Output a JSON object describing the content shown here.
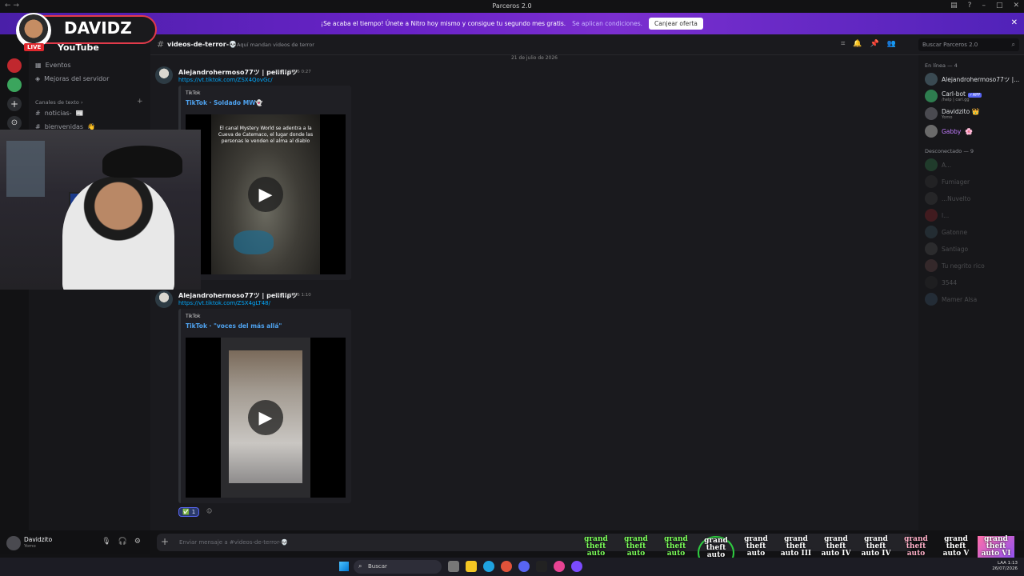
{
  "window": {
    "title": "Parceros 2.0"
  },
  "nitro_banner": {
    "message": "¡Se acaba el tiempo! Únete a Nitro hoy mismo y consigue tu segundo mes gratis.",
    "conditions": "Se aplican condiciones.",
    "button": "Canjear oferta"
  },
  "server": {
    "name": "Parceros 2.0"
  },
  "sidebar": {
    "items": [
      {
        "label": "Eventos",
        "icon": "calendar-icon"
      },
      {
        "label": "Mejoras del servidor",
        "icon": "boost-icon"
      }
    ],
    "category": "Canales de texto",
    "channels": [
      {
        "label": "noticias-",
        "emoji": "📰"
      },
      {
        "label": "bienvenidas",
        "emoji": "👋"
      }
    ]
  },
  "channel": {
    "name": "videos-de-terror-💀",
    "topic": "Aquí mandan videos de terror",
    "search_placeholder": "Buscar Parceros 2.0"
  },
  "messages": {
    "date_divider": "21 de julio de 2026",
    "list": [
      {
        "author": "Alejandrohermoso77ツ | peliflipツ",
        "timestamp": "21/07/2026 0:27",
        "link": "https://vt.tiktok.com/ZSX4QovGc/",
        "provider": "TikTok",
        "embed_title": "TikTok · Soldado MW👻",
        "video_caption": "El canal Mystery World se adentra a la Cueva de Catemaco, el lugar donde las personas le venden el alma al diablo"
      },
      {
        "author": "Alejandrohermoso77ツ | peliflipツ",
        "timestamp": "21/07/2026 1:10",
        "link": "https://vt.tiktok.com/ZSX4gLT48/",
        "provider": "TikTok",
        "embed_title": "TikTok · \"voces del más allá\"",
        "video_caption": ""
      }
    ],
    "reaction": {
      "emoji": "✅",
      "count": "1"
    }
  },
  "composer": {
    "placeholder": "Enviar mensaje a #videos-de-terror-💀"
  },
  "user_panel": {
    "name": "Davidzito",
    "status": "Yomo"
  },
  "members": {
    "online_header": "En línea — 4",
    "online": [
      {
        "name": "Alejandrohermoso77ツ |...",
        "sub": "",
        "color": "#dbdee1"
      },
      {
        "name": "Carl-bot",
        "sub": "/help | carl.gg",
        "color": "#dbdee1",
        "badge": "✓APP"
      },
      {
        "name": "Davidzito",
        "sub": "Yomo",
        "color": "#dbdee1",
        "emoji": "👑"
      },
      {
        "name": "Gabby",
        "sub": "",
        "color": "#c27cfe",
        "emoji": "🌸"
      }
    ],
    "offline_header": "Desconectado — 9",
    "offline": [
      "A...",
      "Fumiager",
      "...Nuvelto",
      "l...",
      "Gatonne",
      "Santiago",
      "Tu negrito rico",
      "3544",
      "Mamer Alsa"
    ]
  },
  "stream_overlay": {
    "name": "DAVIDZ",
    "live": "LIVE",
    "platform": "YouTube"
  },
  "taskbar": {
    "search": "Buscar",
    "time": "1:13",
    "date": "26/07/2026",
    "lang": "LAA"
  },
  "gta_logos": [
    "grand theft auto",
    "grand theft auto",
    "grand theft auto",
    "grand theft auto",
    "grand theft auto",
    "grand theft auto III",
    "grand theft auto IV",
    "grand theft auto IV",
    "grand theft auto",
    "grand theft auto V",
    "grand theft auto VI"
  ]
}
